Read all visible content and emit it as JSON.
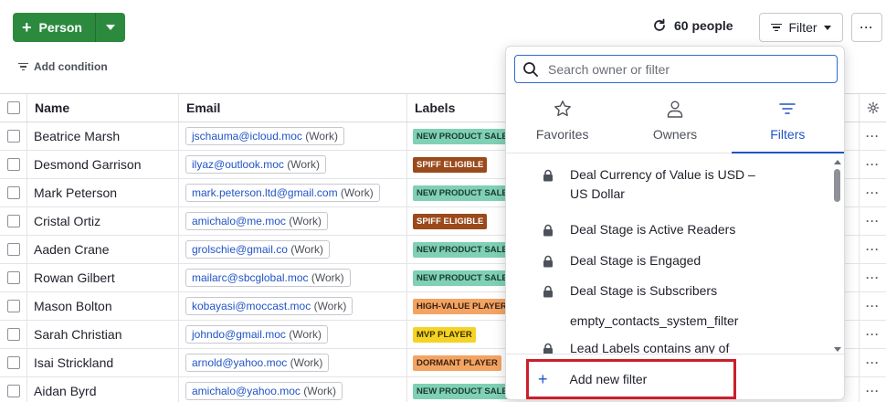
{
  "toolbar": {
    "person_label": "Person",
    "add_condition": "Add condition",
    "people_count": "60 people",
    "filter_label": "Filter",
    "more_label": "···"
  },
  "table": {
    "headers": {
      "name": "Name",
      "email": "Email",
      "labels": "Labels"
    },
    "rows": [
      {
        "name": "Beatrice Marsh",
        "email": "jschauma@icloud.moc",
        "kind": "(Work)",
        "label": "NEW PRODUCT SALE",
        "label_color": "green"
      },
      {
        "name": "Desmond Garrison",
        "email": "ilyaz@outlook.moc",
        "kind": "(Work)",
        "label": "SPIFF ELIGIBLE",
        "label_color": "brown"
      },
      {
        "name": "Mark Peterson",
        "email": "mark.peterson.ltd@gmail.com",
        "kind": "(Work)",
        "label": "NEW PRODUCT SALE",
        "label_color": "green"
      },
      {
        "name": "Cristal Ortiz",
        "email": "amichalo@me.moc",
        "kind": "(Work)",
        "label": "SPIFF ELIGIBLE",
        "label_color": "brown"
      },
      {
        "name": "Aaden Crane",
        "email": "grolschie@gmail.co",
        "kind": "(Work)",
        "label": "NEW PRODUCT SALE",
        "label_color": "green"
      },
      {
        "name": "Rowan Gilbert",
        "email": "mailarc@sbcglobal.moc",
        "kind": "(Work)",
        "label": "NEW PRODUCT SALE",
        "label_color": "green"
      },
      {
        "name": "Mason Bolton",
        "email": "kobayasi@moccast.moc",
        "kind": "(Work)",
        "label": "HIGH-VALUE PLAYER",
        "label_color": "orange"
      },
      {
        "name": "Sarah Christian",
        "email": "johndo@gmail.moc",
        "kind": "(Work)",
        "label": "MVP PLAYER",
        "label_color": "yellow"
      },
      {
        "name": "Isai Strickland",
        "email": "arnold@yahoo.moc",
        "kind": "(Work)",
        "label": "DORMANT PLAYER",
        "label_color": "orange"
      },
      {
        "name": "Aidan Byrd",
        "email": "amichalo@yahoo.moc",
        "kind": "(Work)",
        "label": "NEW PRODUCT SALE",
        "label_color": "green"
      }
    ]
  },
  "panel": {
    "search_placeholder": "Search owner or filter",
    "tabs": [
      {
        "label": "Favorites",
        "icon": "star-icon"
      },
      {
        "label": "Owners",
        "icon": "user-icon"
      },
      {
        "label": "Filters",
        "icon": "filter-icon"
      }
    ],
    "items": [
      {
        "text": "Deal Currency of Value is USD – US Dollar",
        "locked": true
      },
      {
        "text": "Deal Stage is Active Readers",
        "locked": true
      },
      {
        "text": "Deal Stage is Engaged",
        "locked": true
      },
      {
        "text": "Deal Stage is Subscribers",
        "locked": true
      },
      {
        "text": "empty_contacts_system_filter",
        "locked": false
      },
      {
        "text": "Lead Labels contains any of",
        "locked": true
      }
    ],
    "add_new_filter": "Add new filter"
  },
  "colors": {
    "primary_green": "#2c8a3f",
    "link_blue": "#2154c5",
    "highlight_red": "#cc1f2a"
  }
}
